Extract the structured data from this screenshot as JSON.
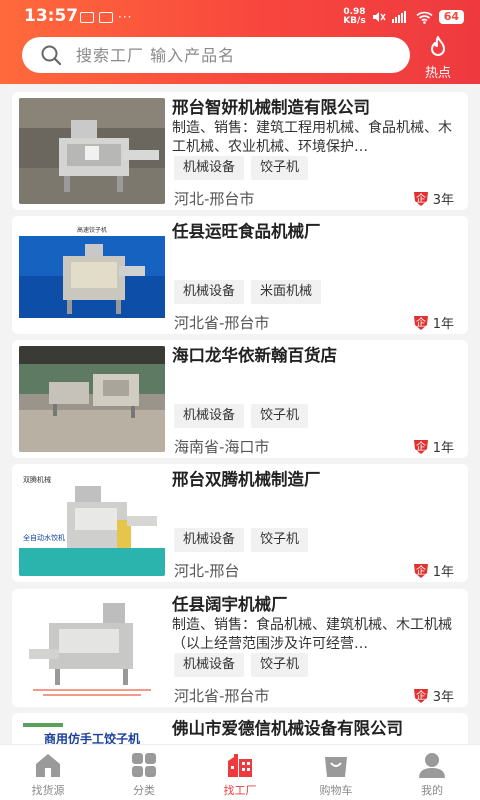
{
  "status": {
    "time": "13:57",
    "net_speed_top": "0.98",
    "net_speed_bottom": "KB/s",
    "battery": "64"
  },
  "search": {
    "placeholder": "搜索工厂 输入产品名"
  },
  "hot": {
    "label": "热点"
  },
  "factories": [
    {
      "name": "邢台智妍机械制造有限公司",
      "desc": "制造、销售：建筑工程用机械、食品机械、木工机械、农业机械、环境保护…",
      "tags": [
        "机械设备",
        "饺子机"
      ],
      "location": "河北-邢台市",
      "badge": "企",
      "years": "3年"
    },
    {
      "name": "任县运旺食品机械厂",
      "desc": "",
      "tags": [
        "机械设备",
        "米面机械"
      ],
      "location": "河北省-邢台市",
      "badge": "企",
      "years": "1年"
    },
    {
      "name": "海口龙华依新翰百货店",
      "desc": "",
      "tags": [
        "机械设备",
        "饺子机"
      ],
      "location": "海南省-海口市",
      "badge": "企",
      "years": "1年"
    },
    {
      "name": "邢台双腾机械制造厂",
      "desc": "",
      "tags": [
        "机械设备",
        "饺子机"
      ],
      "location": "河北-邢台",
      "badge": "企",
      "years": "1年"
    },
    {
      "name": "任县阔宇机械厂",
      "desc": "制造、销售：食品机械、建筑机械、木工机械（以上经营范围涉及许可经营…",
      "tags": [
        "机械设备",
        "饺子机"
      ],
      "location": "河北省-邢台市",
      "badge": "企",
      "years": "3年"
    },
    {
      "name": "佛山市爱德信机械设备有限公司",
      "desc": "",
      "tags": [],
      "location": "",
      "badge": "",
      "years": ""
    }
  ],
  "image_text": {
    "card2_banner": "高速饺子机",
    "card4_brand": "双腾机械",
    "card4_caption": "全自动水饺机",
    "card6_banner": "商用仿手工饺子机"
  },
  "tabs": [
    {
      "label": "找货源",
      "icon": "home-icon",
      "active": false
    },
    {
      "label": "分类",
      "icon": "category-icon",
      "active": false
    },
    {
      "label": "找工厂",
      "icon": "factory-icon",
      "active": true
    },
    {
      "label": "购物车",
      "icon": "cart-icon",
      "active": false
    },
    {
      "label": "我的",
      "icon": "user-icon",
      "active": false
    }
  ],
  "colors": {
    "brand": "#ee3a3f",
    "header_start": "#ff6a3b",
    "tag_bg": "#f1f1f1"
  }
}
